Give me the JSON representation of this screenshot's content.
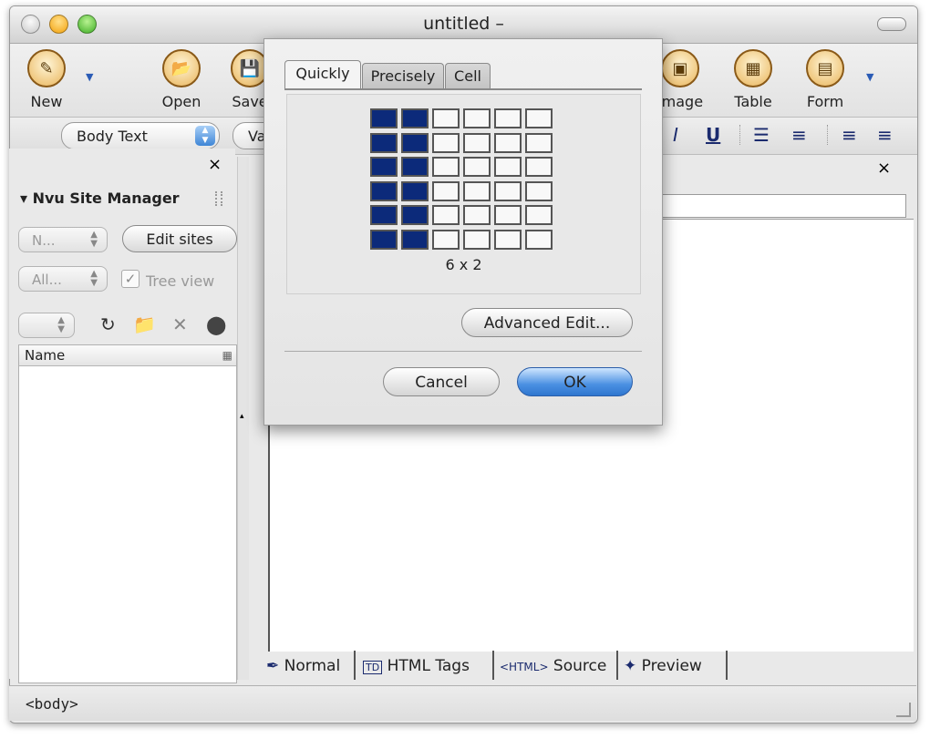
{
  "window": {
    "title": "untitled –"
  },
  "toolbar": {
    "new_label": "New",
    "open_label": "Open",
    "save_label": "Save",
    "image_label": "Image",
    "table_label": "Table",
    "form_label": "Form"
  },
  "format_bar": {
    "paragraph_style": "Body Text",
    "font_partial": "Va",
    "italic": "I",
    "underline": "U"
  },
  "sidebar": {
    "close": "×",
    "title": "Nvu Site Manager",
    "site_select": "N...",
    "edit_sites": "Edit sites",
    "filter_select": "All...",
    "tree_view": "Tree view",
    "list_header": "Name"
  },
  "editor": {
    "tab_close": "×",
    "bottom_tabs": [
      "Normal",
      "HTML Tags",
      "Source",
      "Preview"
    ],
    "tags_badge": "TD",
    "source_badge": "<HTML>"
  },
  "status": {
    "text": "<body>"
  },
  "table_dialog": {
    "tabs": [
      "Quickly",
      "Precisely",
      "Cell"
    ],
    "active_tab": "Quickly",
    "grid_size_label": "6 x 2",
    "advanced_edit": "Advanced Edit...",
    "cancel": "Cancel",
    "ok": "OK",
    "grid_columns": 6,
    "grid_rows": 6,
    "selected_rows": 6,
    "selected_cols": 2,
    "selected_color": "#0c2a7a"
  }
}
